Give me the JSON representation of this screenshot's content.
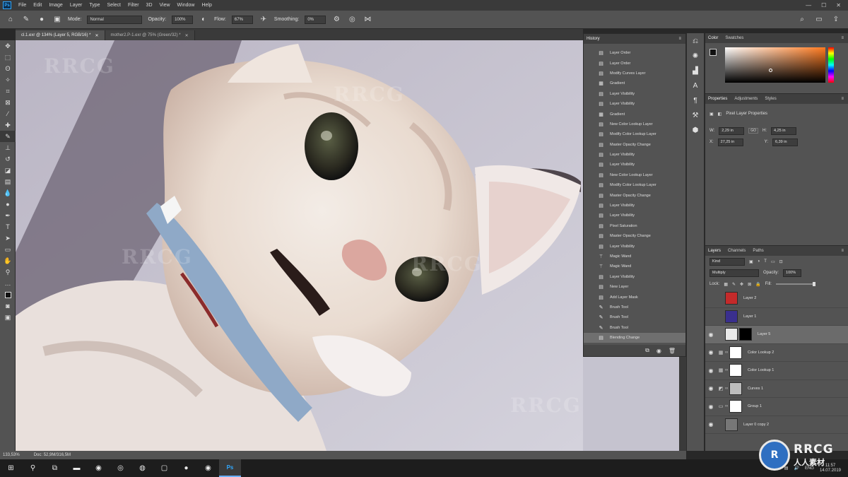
{
  "menubar": {
    "app_logo": "Ps",
    "items": [
      "File",
      "Edit",
      "Image",
      "Layer",
      "Type",
      "Select",
      "Filter",
      "3D",
      "View",
      "Window",
      "Help"
    ]
  },
  "options_bar": {
    "mode_label": "Mode:",
    "mode_value": "Normal",
    "opacity_label": "Opacity:",
    "opacity_value": "100%",
    "flow_label": "Flow:",
    "flow_value": "67%",
    "smoothing_label": "Smoothing:",
    "smoothing_value": "0%"
  },
  "tabs": [
    {
      "label": "cl.1.exr @ 134% (Layer 5, RGB/16) *"
    },
    {
      "label": "mother2.P-1.exr @ 75% (Green/32) *"
    }
  ],
  "status": {
    "zoom": "133,53%",
    "doc": "Doc: 52,9M/316,5M"
  },
  "history": {
    "title": "History",
    "items": [
      {
        "label": "Layer Order",
        "icon": "layer-icon"
      },
      {
        "label": "Layer Order",
        "icon": "layer-icon"
      },
      {
        "label": "Modify Curves Layer",
        "icon": "layer-icon"
      },
      {
        "label": "Gradient",
        "icon": "gradient-icon"
      },
      {
        "label": "Layer Visibility",
        "icon": "layer-icon"
      },
      {
        "label": "Layer Visibility",
        "icon": "layer-icon"
      },
      {
        "label": "Gradient",
        "icon": "gradient-icon"
      },
      {
        "label": "New Color Lookup Layer",
        "icon": "layer-icon"
      },
      {
        "label": "Modify Color Lookup Layer",
        "icon": "layer-icon"
      },
      {
        "label": "Master Opacity Change",
        "icon": "layer-icon"
      },
      {
        "label": "Layer Visibility",
        "icon": "layer-icon"
      },
      {
        "label": "Layer Visibility",
        "icon": "layer-icon"
      },
      {
        "label": "New Color Lookup Layer",
        "icon": "layer-icon"
      },
      {
        "label": "Modify Color Lookup Layer",
        "icon": "layer-icon"
      },
      {
        "label": "Master Opacity Change",
        "icon": "layer-icon"
      },
      {
        "label": "Layer Visibility",
        "icon": "layer-icon"
      },
      {
        "label": "Layer Visibility",
        "icon": "layer-icon"
      },
      {
        "label": "Pixel Saturation",
        "icon": "layer-icon"
      },
      {
        "label": "Master Opacity Change",
        "icon": "layer-icon"
      },
      {
        "label": "Layer Visibility",
        "icon": "layer-icon"
      },
      {
        "label": "Magic Wand",
        "icon": "wand-icon"
      },
      {
        "label": "Magic Wand",
        "icon": "wand-icon"
      },
      {
        "label": "Layer Visibility",
        "icon": "layer-icon"
      },
      {
        "label": "New Layer",
        "icon": "layer-icon"
      },
      {
        "label": "Add Layer Mask",
        "icon": "layer-icon"
      },
      {
        "label": "Brush Tool",
        "icon": "brush-icon"
      },
      {
        "label": "Brush Tool",
        "icon": "brush-icon"
      },
      {
        "label": "Brush Tool",
        "icon": "brush-icon"
      },
      {
        "label": "Blending Change",
        "icon": "layer-icon",
        "selected": true
      }
    ]
  },
  "color_panel": {
    "tabs": [
      "Color",
      "Swatches"
    ]
  },
  "properties_panel": {
    "tabs": [
      "Properties",
      "Adjustments",
      "Styles"
    ],
    "header": "Pixel Layer Properties",
    "w_label": "W:",
    "w_value": "2,29 in",
    "h_label": "H:",
    "h_value": "4,25 in",
    "x_label": "X:",
    "x_value": "27,25 in",
    "y_label": "Y:",
    "y_value": "6,39 in",
    "link_label": "GO"
  },
  "layers_panel": {
    "tabs": [
      "Layers",
      "Channels",
      "Paths"
    ],
    "filter_kind": "Kind",
    "blend_mode": "Multiply",
    "opacity_label": "Opacity:",
    "opacity_value": "100%",
    "lock_label": "Lock:",
    "fill_label": "Fill:",
    "fill_value": "100%",
    "layers": [
      {
        "name": "Layer 2",
        "visible": false,
        "thumb": "#c42a2a",
        "type": ""
      },
      {
        "name": "Layer 1",
        "visible": false,
        "thumb": "#3a2f8e",
        "type": ""
      },
      {
        "name": "Layer 5",
        "visible": true,
        "thumb": "#e8e8e8",
        "mask": "#000000",
        "type": "",
        "selected": true
      },
      {
        "name": "Color Lookup 2",
        "visible": true,
        "thumb": "#ffffff",
        "type": "adj"
      },
      {
        "name": "Color Lookup 1",
        "visible": true,
        "thumb": "#ffffff",
        "type": "adj"
      },
      {
        "name": "Curves 1",
        "visible": true,
        "thumb": "#bdbdbd",
        "type": "curves"
      },
      {
        "name": "Group 1",
        "visible": true,
        "thumb": "#ffffff",
        "type": "group"
      },
      {
        "name": "Layer 0 copy 2",
        "visible": true,
        "thumb": "#777777",
        "type": ""
      }
    ]
  },
  "taskbar": {
    "language": "ENG",
    "time": "11:57",
    "date": "14.07.2019"
  },
  "watermark": {
    "text": "RRCG",
    "brand_line1": "RRCG",
    "brand_line2": "人人素材"
  },
  "colors": {
    "accent": "#31a8ff",
    "canvas_bg": "#c9c7d1",
    "panel_bg": "#535353",
    "taskbar_bg": "#1d1d1d"
  }
}
